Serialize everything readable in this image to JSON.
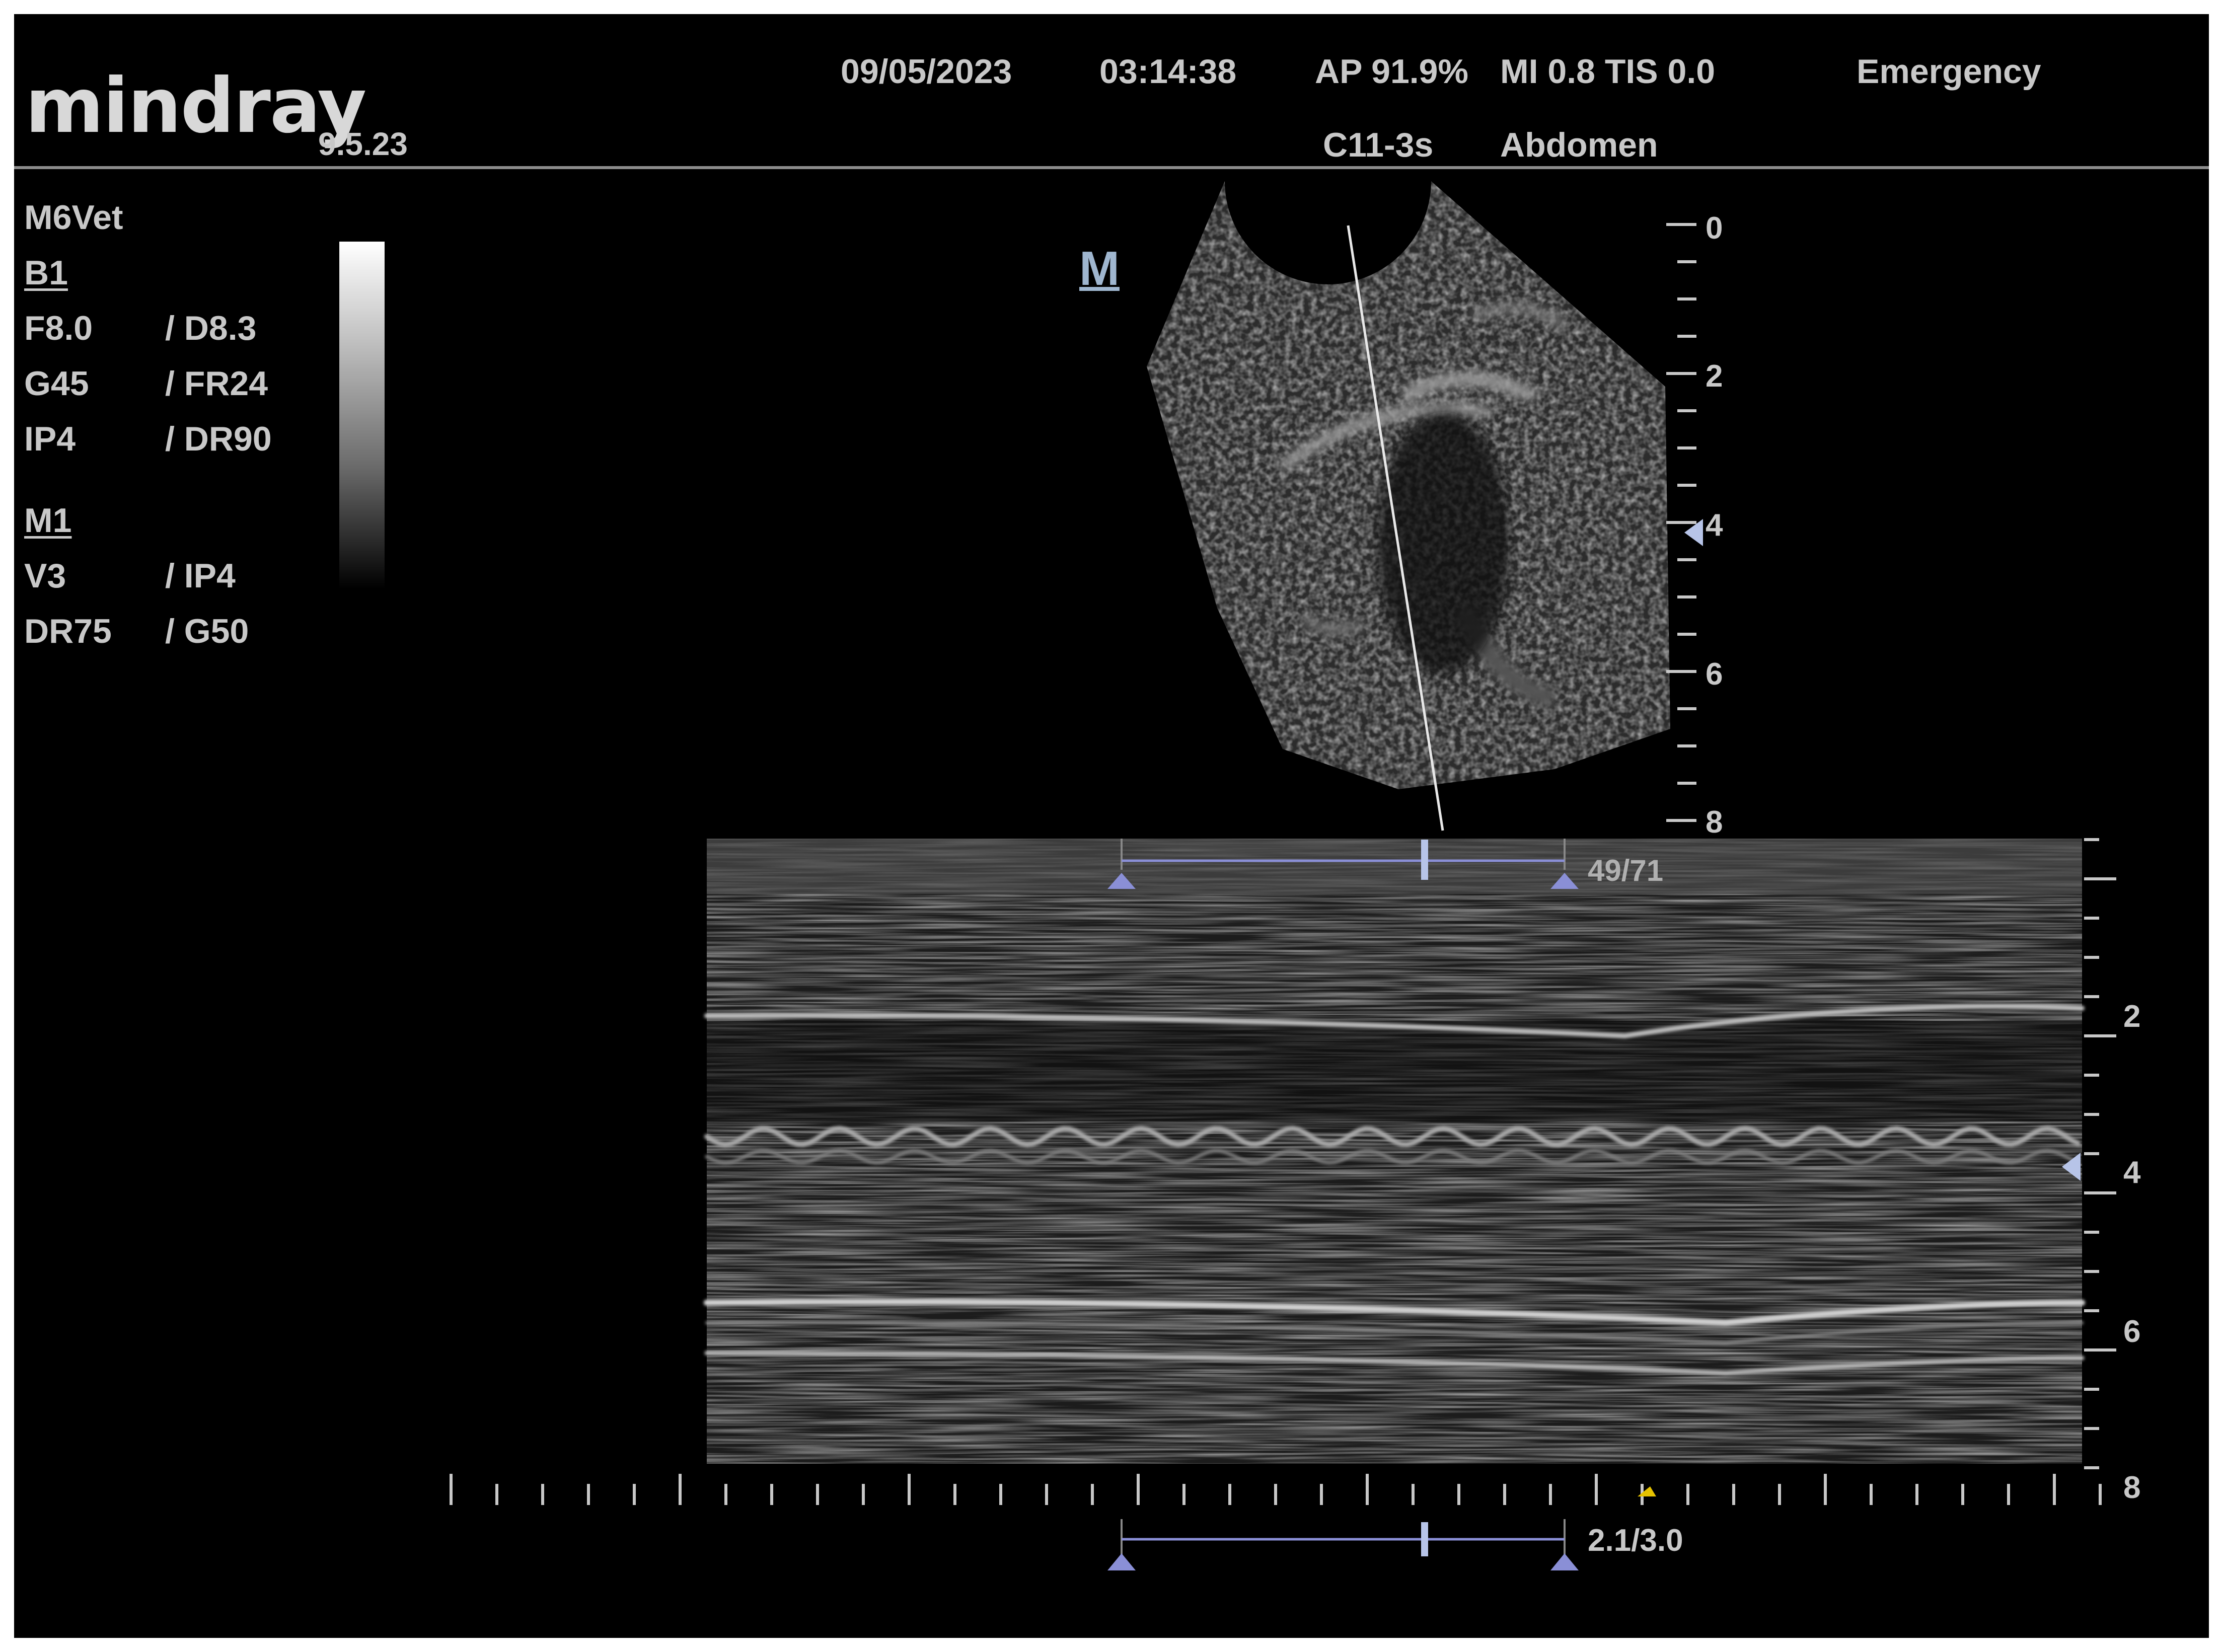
{
  "header": {
    "brand": "mindray",
    "version": "9.5.23",
    "date": "09/05/2023",
    "time": "03:14:38",
    "ap": "AP 91.9%",
    "mi_tis": "MI 0.8 TIS 0.0",
    "mode": "Emergency",
    "probe": "C11-3s",
    "preset": "Abdomen"
  },
  "params": {
    "device": "M6Vet",
    "b_section": "B1",
    "b_rows": [
      {
        "left": "F8.0",
        "right": "/ D8.3"
      },
      {
        "left": "G45",
        "right": "/ FR24"
      },
      {
        "left": "IP4",
        "right": "/ DR90"
      }
    ],
    "m_section": "M1",
    "m_rows": [
      {
        "left": "V3",
        "right": "/ IP4"
      },
      {
        "left": "DR75",
        "right": "/ G50"
      }
    ]
  },
  "bmode": {
    "marker": "M",
    "depth_labels": [
      "0",
      "2",
      "4",
      "6",
      "8"
    ]
  },
  "mmode": {
    "depth_labels": [
      "2",
      "4",
      "6",
      "8"
    ],
    "measure_top": "49/71",
    "measure_bottom": "2.1/3.0"
  },
  "colors": {
    "background": "#000000",
    "text": "#c8c8c8",
    "caliper": "#8a8fd6",
    "marker_arrow": "#b7c4e8",
    "cursor_marker": "#e6c200"
  }
}
